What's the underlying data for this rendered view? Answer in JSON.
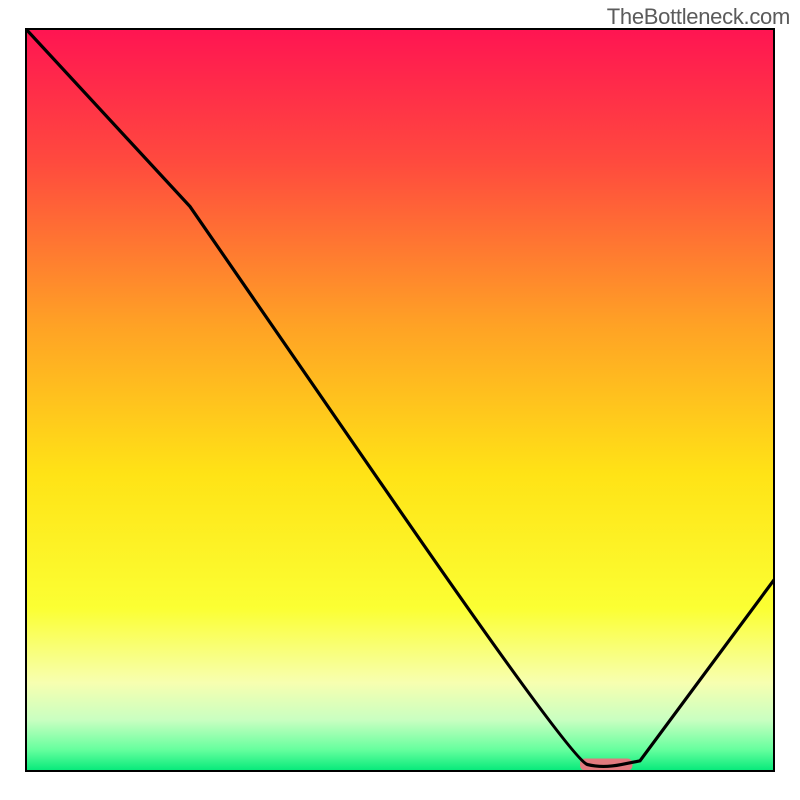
{
  "watermark": "TheBottleneck.com",
  "chart_data": {
    "type": "line",
    "title": "",
    "xlabel": "",
    "ylabel": "",
    "x_range": [
      0,
      100
    ],
    "y_range": [
      0,
      100
    ],
    "series": [
      {
        "name": "curve",
        "points": [
          {
            "x": 0,
            "y": 100
          },
          {
            "x": 22,
            "y": 76
          },
          {
            "x": 73,
            "y": 1.5
          },
          {
            "x": 77,
            "y": 0.5
          },
          {
            "x": 82,
            "y": 1.5
          },
          {
            "x": 100,
            "y": 26
          }
        ],
        "color": "#000000"
      }
    ],
    "marker": {
      "x_start": 74,
      "x_end": 81,
      "y": 1.0,
      "color": "#e27a7f"
    },
    "gradient_stops": [
      {
        "offset": 0,
        "color": "#ff1452"
      },
      {
        "offset": 0.18,
        "color": "#ff4a3e"
      },
      {
        "offset": 0.4,
        "color": "#ffa225"
      },
      {
        "offset": 0.6,
        "color": "#ffe316"
      },
      {
        "offset": 0.78,
        "color": "#fbff33"
      },
      {
        "offset": 0.88,
        "color": "#f7ffb0"
      },
      {
        "offset": 0.93,
        "color": "#c9ffc1"
      },
      {
        "offset": 0.97,
        "color": "#66ff9e"
      },
      {
        "offset": 1.0,
        "color": "#00e878"
      }
    ]
  }
}
